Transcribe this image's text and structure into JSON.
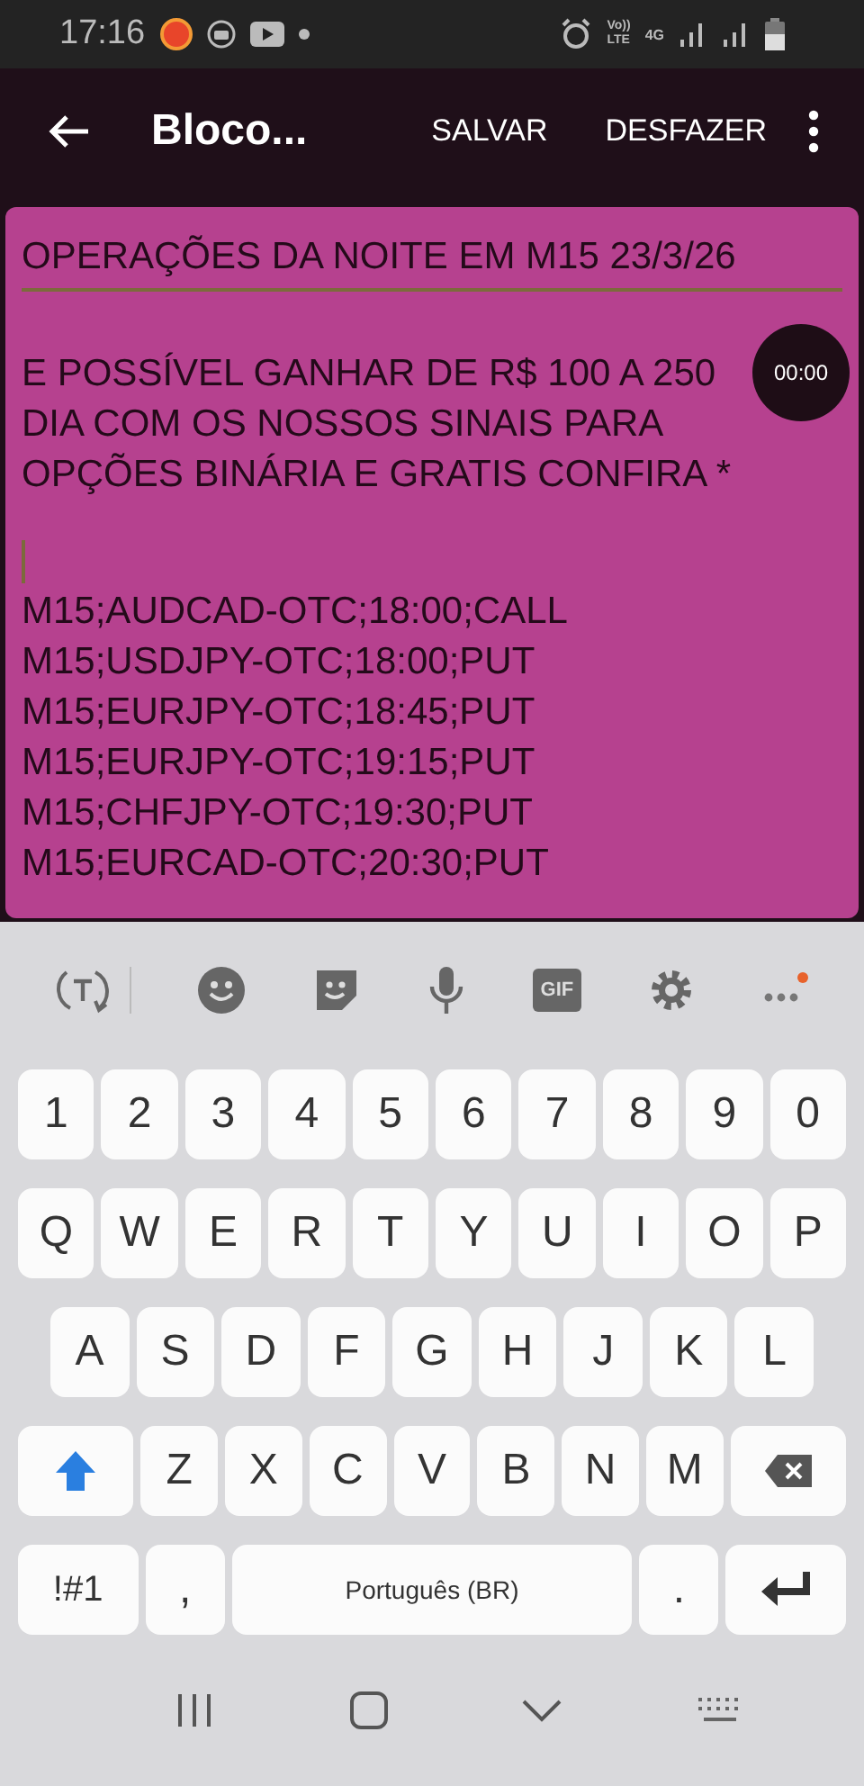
{
  "status_bar": {
    "time": "17:16",
    "volte_top": "Vo))",
    "volte_bottom": "LTE",
    "network": "4G"
  },
  "app_bar": {
    "title": "Bloco...",
    "actions": [
      "SALVAR",
      "DESFAZER"
    ]
  },
  "note": {
    "title": "OPERAÇÕES DA NOITE EM M15 23/3/26",
    "body_lines": [
      "E POSSÍVEL GANHAR DE R$ 100 A 250",
      "DIA COM OS NOSSOS SINAIS PARA",
      "OPÇÕES BINÁRIA E GRATIS CONFIRA *"
    ],
    "signals": [
      "M15;AUDCAD-OTC;18:00;CALL",
      "M15;USDJPY-OTC;18:00;PUT",
      "M15;EURJPY-OTC;18:45;PUT",
      "M15;EURJPY-OTC;19:15;PUT",
      "M15;CHFJPY-OTC;19:30;PUT",
      "M15;EURCAD-OTC;20:30;PUT"
    ]
  },
  "recorder": {
    "time": "00:00"
  },
  "keyboard": {
    "toolbar": [
      {
        "kind": "translate"
      },
      {
        "kind": "emoji"
      },
      {
        "kind": "sticker"
      },
      {
        "kind": "mic"
      },
      {
        "kind": "gif",
        "label": "GIF"
      },
      {
        "kind": "settings"
      },
      {
        "kind": "more"
      }
    ],
    "rows": [
      [
        "1",
        "2",
        "3",
        "4",
        "5",
        "6",
        "7",
        "8",
        "9",
        "0"
      ],
      [
        "Q",
        "W",
        "E",
        "R",
        "T",
        "Y",
        "U",
        "I",
        "O",
        "P"
      ],
      [
        "A",
        "S",
        "D",
        "F",
        "G",
        "H",
        "J",
        "K",
        "L"
      ]
    ],
    "row4": [
      "Z",
      "X",
      "C",
      "V",
      "B",
      "N",
      "M"
    ],
    "bottom": {
      "symbols": "!#1",
      "comma": ",",
      "space": "Português (BR)",
      "period": "."
    }
  }
}
